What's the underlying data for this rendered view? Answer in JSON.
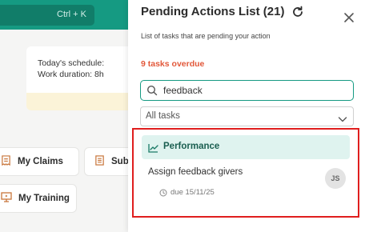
{
  "background": {
    "search_shortcut": "Ctrl + K",
    "schedule_line": "Today's schedule:",
    "duration_line": "Work duration: 8h",
    "tiles": {
      "claims": "My Claims",
      "sub": "Sub",
      "training": "My Training"
    }
  },
  "panel": {
    "title": "Pending Actions List (21)",
    "subtitle": "List of tasks that are pending your action",
    "overdue": "9 tasks overdue",
    "search": {
      "value": "feedback"
    },
    "filter": {
      "selected": "All tasks"
    },
    "group": {
      "label": "Performance",
      "tasks": [
        {
          "name": "Assign feedback givers",
          "due": "due 15/11/25",
          "assignee_initials": "JS"
        }
      ]
    }
  },
  "colors": {
    "brand_teal": "#159a82",
    "overdue_red": "#e2583a",
    "highlight_red": "#e01e1e",
    "group_bg": "#dff3ef"
  },
  "icons": [
    "refresh-icon",
    "close-icon",
    "search-icon",
    "chevron-down-icon",
    "chart-trend-icon",
    "clock-icon",
    "receipt-icon",
    "training-icon"
  ]
}
